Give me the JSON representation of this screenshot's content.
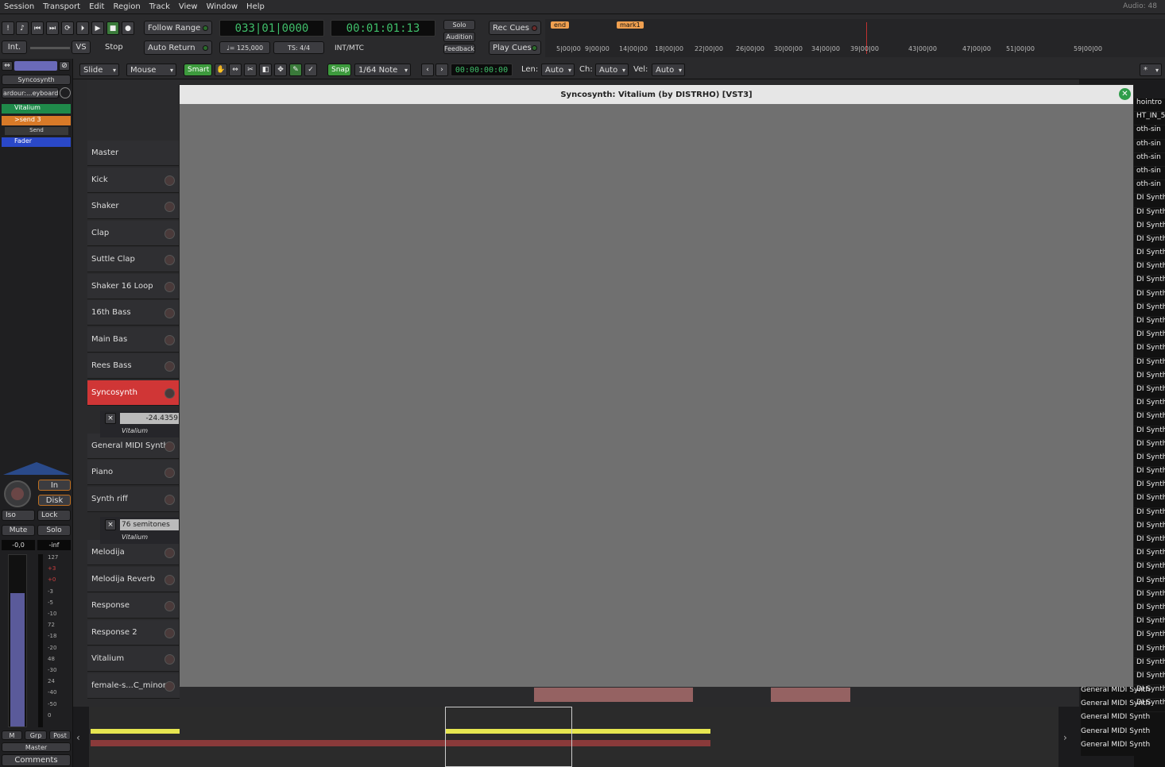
{
  "menu": [
    "Session",
    "Transport",
    "Edit",
    "Region",
    "Track",
    "View",
    "Window",
    "Help"
  ],
  "audio_status": "Audio: 48",
  "transport": {
    "int_label": "Int.",
    "vs_label": "VS",
    "stop_label": "Stop",
    "follow_range": "Follow Range",
    "auto_return": "Auto Return",
    "primary_clock": "033|01|0000",
    "secondary_clock": "00:01:01:13",
    "tempo": "♩= 125,000",
    "ts": "TS: 4/4",
    "sync": "INT/MTC",
    "solo": "Solo",
    "audition": "Audition",
    "feedback": "Feedback",
    "rec_cues": "Rec Cues",
    "play_cues": "Play Cues"
  },
  "ruler": {
    "markers": [
      {
        "label": "end"
      },
      {
        "label": "mark1"
      }
    ],
    "ticks": [
      "5|00|00",
      "9|00|00",
      "14|00|00",
      "18|00|00",
      "22|00|00",
      "26|00|00",
      "30|00|00",
      "34|00|00",
      "39|00|00",
      "43|00|00",
      "47|00|00",
      "51|00|00",
      "59|00|00"
    ]
  },
  "toolbar2": {
    "edit_mode": "Slide",
    "ripple": "Mouse",
    "smart": "Smart",
    "snap": "Snap",
    "grid": "1/64 Note",
    "nudge_clock": "00:00:00:00",
    "len_label": "Len:",
    "len_value": "Auto",
    "ch_label": "Ch:",
    "ch_value": "Auto",
    "vel_label": "Vel:",
    "vel_value": "Auto",
    "asterisk": "*"
  },
  "strip": {
    "name": "Syncosynth",
    "input": "ardour:...eyboard",
    "plugins": [
      "Vitalium",
      ">send 3",
      "Send",
      "Fader"
    ],
    "in_label": "In",
    "disk_label": "Disk",
    "iso": "Iso",
    "lock": "Lock",
    "mute": "Mute",
    "solo": "Solo",
    "gain": "-0,0",
    "peak": "-inf",
    "meter_scale": [
      "127",
      "+3",
      "+0",
      "-3",
      "-5",
      "-10",
      "72",
      "-18",
      "-20",
      "48",
      "-30",
      "24",
      "-40",
      "-50",
      "0"
    ],
    "m": "M",
    "grp": "Grp",
    "post": "Post",
    "master": "Master",
    "comments": "Comments"
  },
  "tracks": [
    {
      "name": "Master"
    },
    {
      "name": "Kick"
    },
    {
      "name": "Shaker"
    },
    {
      "name": "Clap"
    },
    {
      "name": "Suttle Clap"
    },
    {
      "name": "Shaker 16 Loop"
    },
    {
      "name": "16th Bass"
    },
    {
      "name": "Main Bas"
    },
    {
      "name": "Rees Bass"
    },
    {
      "name": "Syncosynth"
    },
    {
      "name": "General MIDI Synth"
    },
    {
      "name": "Piano"
    },
    {
      "name": "Synth riff"
    },
    {
      "name": "Melodija"
    },
    {
      "name": "Melodija Reverb"
    },
    {
      "name": "Response"
    },
    {
      "name": "Response 2"
    },
    {
      "name": "Vitalium"
    },
    {
      "name": "female-s...C_minor"
    }
  ],
  "automation1": {
    "value": "-24.4359",
    "plugin": "Vitalium"
  },
  "automation2": {
    "value": "76 semitones",
    "plugin": "Vitalium"
  },
  "dialog": {
    "title": "Syncosynth: Vitalium (by DISTRHO) [VST3]"
  },
  "regions_list": [
    "hointro",
    "HT_IN_5",
    "oth-sin",
    "oth-sin",
    "oth-sin",
    "oth-sin",
    "oth-sin",
    "DI Synth",
    "DI Synth",
    "DI Synth",
    "DI Synth",
    "DI Synth",
    "DI Synth",
    "DI Synth",
    "DI Synth",
    "DI Synth",
    "DI Synth",
    "DI Synth",
    "DI Synth",
    "DI Synth",
    "DI Synth",
    "DI Synth",
    "DI Synth",
    "DI Synth",
    "DI Synth",
    "DI Synth",
    "DI Synth",
    "DI Synth",
    "DI Synth",
    "DI Synth",
    "DI Synth",
    "DI Synth",
    "DI Synth",
    "DI Synth",
    "DI Synth",
    "DI Synth",
    "DI Synth",
    "DI Synth",
    "DI Synth",
    "DI Synth",
    "DI Synth",
    "DI Synth",
    "DI Synth",
    "DI Synth",
    "DI Synth"
  ],
  "general_list": [
    "General MIDI Synth",
    "General MIDI Synth",
    "General MIDI Synth",
    "General MIDI Synth",
    "General MIDI Synth"
  ]
}
